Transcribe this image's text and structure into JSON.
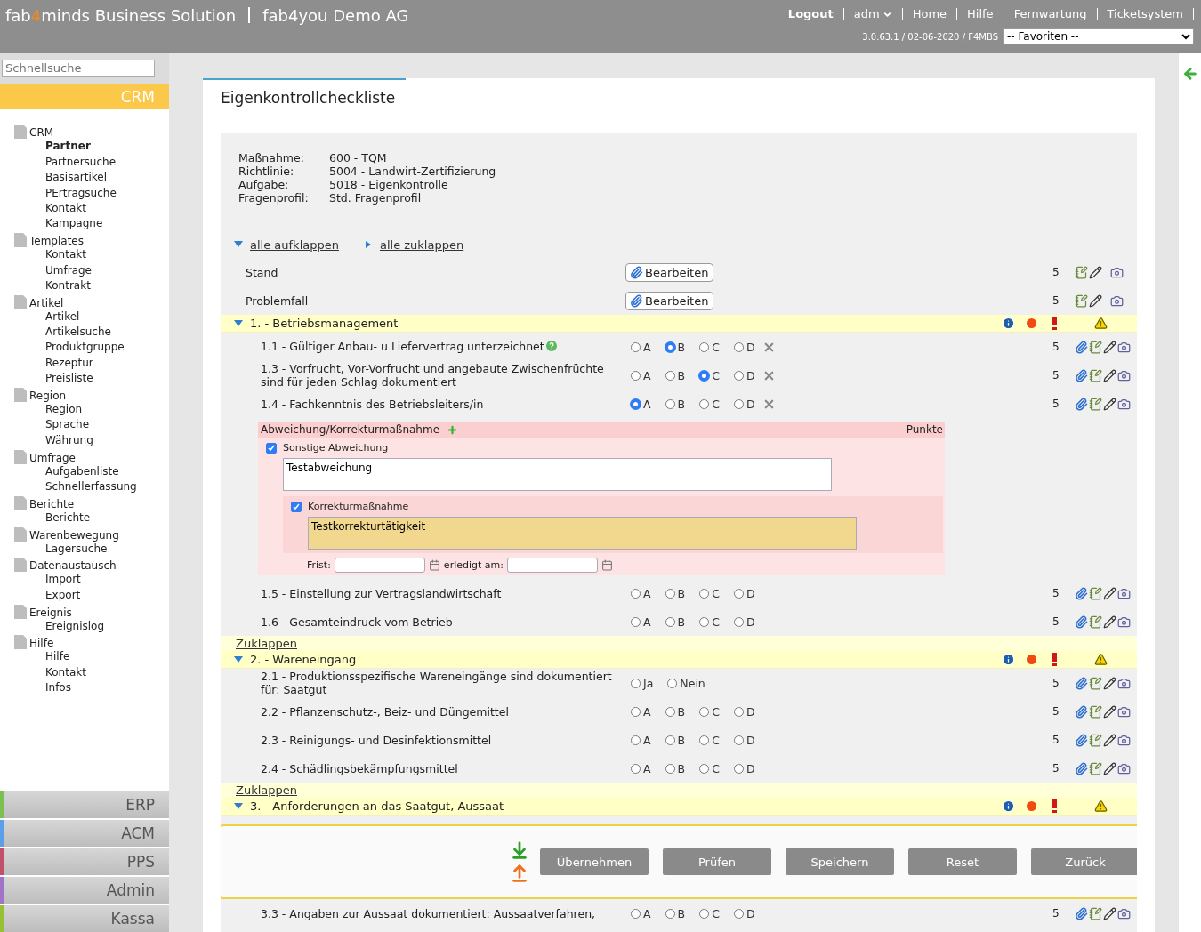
{
  "header": {
    "brand": {
      "prefix": "fab",
      "accent": "4",
      "suffix": "minds Business Solution"
    },
    "company": "fab4you Demo AG",
    "nav": [
      {
        "label": "Logout",
        "kind": "bold"
      },
      {
        "label": "adm",
        "kind": "menu"
      },
      {
        "label": "Home",
        "kind": "link"
      },
      {
        "label": "Hilfe",
        "kind": "link"
      },
      {
        "label": "Fernwartung",
        "kind": "link"
      },
      {
        "label": "Ticketsystem",
        "kind": "link"
      }
    ],
    "version": "3.0.63.1 / 02-06-2020 / F4MBS",
    "favorites": "-- Favoriten --"
  },
  "sidebar": {
    "search": {
      "placeholder": "Schnellsuche"
    },
    "module": "CRM",
    "tree": [
      {
        "label": "CRM",
        "selected": false,
        "children": [
          {
            "label": "Partner",
            "selected": true
          },
          {
            "label": "Partnersuche",
            "selected": false
          },
          {
            "label": "Basisartikel",
            "selected": false
          },
          {
            "label": "PErtragsuche",
            "selected": false
          },
          {
            "label": "Kontakt",
            "selected": false
          },
          {
            "label": "Kampagne",
            "selected": false
          }
        ]
      },
      {
        "label": "Templates",
        "selected": false,
        "children": [
          {
            "label": "Kontakt",
            "selected": false
          },
          {
            "label": "Umfrage",
            "selected": false
          },
          {
            "label": "Kontrakt",
            "selected": false
          }
        ]
      },
      {
        "label": "Artikel",
        "selected": false,
        "children": [
          {
            "label": "Artikel",
            "selected": false
          },
          {
            "label": "Artikelsuche",
            "selected": false
          },
          {
            "label": "Produktgruppe",
            "selected": false
          },
          {
            "label": "Rezeptur",
            "selected": false
          },
          {
            "label": "Preisliste",
            "selected": false
          }
        ]
      },
      {
        "label": "Region",
        "selected": false,
        "children": [
          {
            "label": "Region",
            "selected": false
          },
          {
            "label": "Sprache",
            "selected": false
          },
          {
            "label": "Währung",
            "selected": false
          }
        ]
      },
      {
        "label": "Umfrage",
        "selected": false,
        "children": [
          {
            "label": "Aufgabenliste",
            "selected": false
          },
          {
            "label": "Schnellerfassung",
            "selected": false
          }
        ]
      },
      {
        "label": "Berichte",
        "selected": false,
        "children": [
          {
            "label": "Berichte",
            "selected": false
          }
        ]
      },
      {
        "label": "Warenbewegung",
        "selected": false,
        "children": [
          {
            "label": "Lagersuche",
            "selected": false
          }
        ]
      },
      {
        "label": "Datenaustausch",
        "selected": false,
        "children": [
          {
            "label": "Import",
            "selected": false
          },
          {
            "label": "Export",
            "selected": false
          }
        ]
      },
      {
        "label": "Ereignis",
        "selected": false,
        "children": [
          {
            "label": "Ereignislog",
            "selected": false
          }
        ]
      },
      {
        "label": "Hilfe",
        "selected": false,
        "children": [
          {
            "label": "Hilfe",
            "selected": false
          },
          {
            "label": "Kontakt",
            "selected": false
          },
          {
            "label": "Infos",
            "selected": false
          }
        ]
      }
    ],
    "modules": [
      {
        "label": "ERP",
        "color": "#7cc050"
      },
      {
        "label": "ACM",
        "color": "#5b9fe8"
      },
      {
        "label": "PPS",
        "color": "#c2506c"
      },
      {
        "label": "Admin",
        "color": "#a272c8"
      },
      {
        "label": "Kassa",
        "color": "#98c034"
      }
    ]
  },
  "page": {
    "title": "Eigenkontrollcheckliste",
    "info": [
      {
        "label": "Maßnahme:",
        "value": "600 - TQM"
      },
      {
        "label": "Richtlinie:",
        "value": "5004 - Landwirt-Zertifizierung"
      },
      {
        "label": "Aufgabe:",
        "value": "5018 - Eigenkontrolle"
      },
      {
        "label": "Fragenprofil:",
        "value": "Std. Fragenprofil"
      }
    ],
    "expand_all": "alle aufklappen",
    "collapse_all": "alle zuklappen",
    "edit_rows": [
      {
        "label": "Stand",
        "button": "Bearbeiten",
        "points": "5"
      },
      {
        "label": "Problemfall",
        "button": "Bearbeiten",
        "points": "5"
      }
    ],
    "sections": [
      {
        "title": "1. - Betriebsmanagement",
        "expanded": true,
        "collapse_link": "Zuklappen",
        "questions": [
          {
            "text": "1.1 - Gültiger Anbau- u Liefervertrag unterzeichnet",
            "help": true,
            "clearable": true,
            "attachment": true,
            "points": "5",
            "options": [
              {
                "label": "A",
                "selected": false
              },
              {
                "label": "B",
                "selected": true
              },
              {
                "label": "C",
                "selected": false
              },
              {
                "label": "D",
                "selected": false
              }
            ]
          },
          {
            "text": "1.3 - Vorfrucht, Vor-Vorfrucht und angebaute Zwischenfrüchte sind für jeden Schlag dokumentiert",
            "help": false,
            "clearable": true,
            "attachment": true,
            "points": "5",
            "options": [
              {
                "label": "A",
                "selected": false
              },
              {
                "label": "B",
                "selected": false
              },
              {
                "label": "C",
                "selected": true
              },
              {
                "label": "D",
                "selected": false
              }
            ]
          },
          {
            "text": "1.4 - Fachkenntnis des Betriebsleiters/in",
            "help": false,
            "clearable": true,
            "attachment": true,
            "points": "5",
            "options": [
              {
                "label": "A",
                "selected": true
              },
              {
                "label": "B",
                "selected": false
              },
              {
                "label": "C",
                "selected": false
              },
              {
                "label": "D",
                "selected": false
              }
            ],
            "deviation": {
              "title": "Abweichung/Korrekturmaßnahme",
              "points_label": "Punkte",
              "other": {
                "label": "Sonstige Abweichung",
                "checked": true,
                "value": "Testabweichung"
              },
              "correction": {
                "label": "Korrekturmaßnahme",
                "checked": true,
                "value": "Testkorrekturtätigkeit"
              },
              "deadline_label": "Frist:",
              "done_label": "erledigt am:"
            }
          },
          {
            "text": "1.5 - Einstellung zur Vertragslandwirtschaft",
            "help": false,
            "clearable": false,
            "attachment": true,
            "points": "5",
            "options": [
              {
                "label": "A",
                "selected": false
              },
              {
                "label": "B",
                "selected": false
              },
              {
                "label": "C",
                "selected": false
              },
              {
                "label": "D",
                "selected": false
              }
            ]
          },
          {
            "text": "1.6 - Gesamteindruck vom Betrieb",
            "help": false,
            "clearable": false,
            "attachment": true,
            "points": "5",
            "options": [
              {
                "label": "A",
                "selected": false
              },
              {
                "label": "B",
                "selected": false
              },
              {
                "label": "C",
                "selected": false
              },
              {
                "label": "D",
                "selected": false
              }
            ]
          }
        ]
      },
      {
        "title": "2. - Wareneingang",
        "expanded": true,
        "collapse_link": "Zuklappen",
        "questions": [
          {
            "text": "2.1 - Produktionsspezifische Wareneingänge sind dokumentiert für: Saatgut",
            "help": false,
            "clearable": false,
            "attachment": true,
            "points": "5",
            "options": [
              {
                "label": "Ja",
                "selected": false
              },
              {
                "label": "Nein",
                "selected": false
              }
            ]
          },
          {
            "text": "2.2 - Pflanzenschutz-, Beiz- und Düngemittel",
            "help": false,
            "clearable": false,
            "attachment": true,
            "points": "5",
            "options": [
              {
                "label": "A",
                "selected": false
              },
              {
                "label": "B",
                "selected": false
              },
              {
                "label": "C",
                "selected": false
              },
              {
                "label": "D",
                "selected": false
              }
            ]
          },
          {
            "text": "2.3 - Reinigungs- und Desinfektionsmittel",
            "help": false,
            "clearable": false,
            "attachment": true,
            "points": "5",
            "options": [
              {
                "label": "A",
                "selected": false
              },
              {
                "label": "B",
                "selected": false
              },
              {
                "label": "C",
                "selected": false
              },
              {
                "label": "D",
                "selected": false
              }
            ]
          },
          {
            "text": "2.4 - Schädlingsbekämpfungsmittel",
            "help": false,
            "clearable": false,
            "attachment": true,
            "points": "5",
            "options": [
              {
                "label": "A",
                "selected": false
              },
              {
                "label": "B",
                "selected": false
              },
              {
                "label": "C",
                "selected": false
              },
              {
                "label": "D",
                "selected": false
              }
            ]
          }
        ]
      },
      {
        "title": "3. - Anforderungen an das Saatgut, Aussaat",
        "expanded": true,
        "questions": [
          {
            "text": "3.3 - Angaben zur Aussaat dokumentiert: Aussaatverfahren,",
            "help": false,
            "clearable": false,
            "attachment": true,
            "points": "5",
            "options": [
              {
                "label": "A",
                "selected": false
              },
              {
                "label": "B",
                "selected": false
              },
              {
                "label": "C",
                "selected": false
              },
              {
                "label": "D",
                "selected": false
              }
            ]
          }
        ]
      }
    ]
  },
  "action_bar": {
    "buttons": [
      "Übernehmen",
      "Prüfen",
      "Speichern",
      "Reset",
      "Zurück"
    ]
  }
}
